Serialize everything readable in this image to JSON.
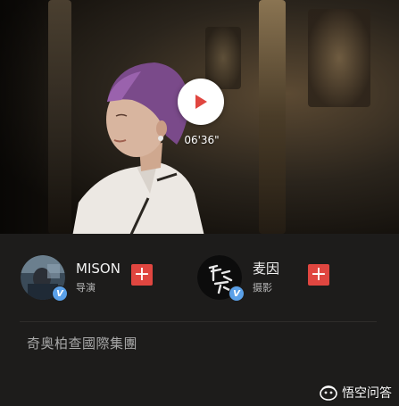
{
  "video": {
    "duration": "06'36\"",
    "icons": {
      "play": "play-icon"
    }
  },
  "creators": [
    {
      "name": "MISON",
      "role": "导演",
      "verified_badge": "V",
      "follow_label": "+"
    },
    {
      "name": "麦因",
      "role": "摄影",
      "verified_badge": "V",
      "follow_label": "+"
    }
  ],
  "company": "奇奥柏查國際集團",
  "watermark": {
    "text": "悟空问答",
    "icon": "wukong-logo-icon"
  },
  "colors": {
    "play_triangle": "#e04640",
    "follow_button": "#e04640",
    "verified_badge": "#5aa0e8",
    "panel_background": "#1d1c1b"
  }
}
